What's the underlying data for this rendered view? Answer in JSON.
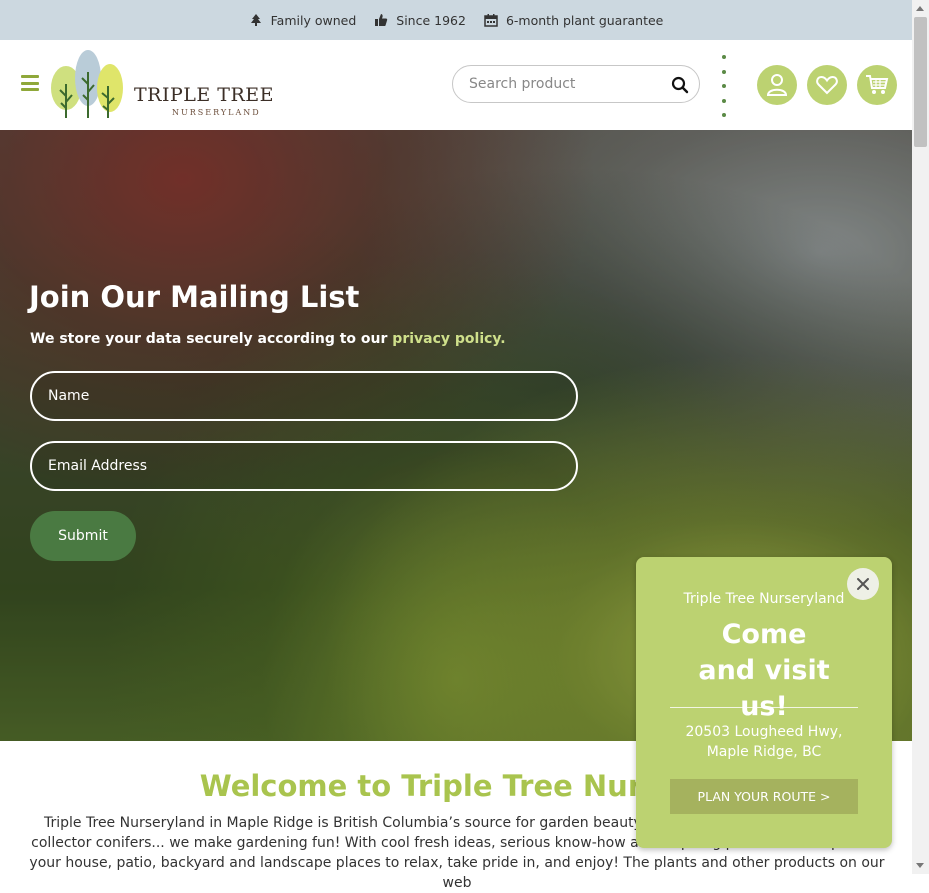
{
  "topbar": {
    "items": [
      {
        "icon": "tree-icon",
        "text": "Family owned"
      },
      {
        "icon": "thumbs-up-icon",
        "text": "Since 1962"
      },
      {
        "icon": "calendar-icon",
        "text": "6-month plant guarantee"
      }
    ]
  },
  "header": {
    "logo_line1": "TRIPLE TREE",
    "logo_line2": "NURSERYLAND",
    "search_placeholder": "Search product",
    "icons": [
      "menu-icon",
      "search-icon",
      "more-dots-icon",
      "account-icon",
      "heart-icon",
      "cart-icon"
    ],
    "accent": "#bcd271"
  },
  "hero": {
    "title": "Join Our Mailing List",
    "note_prefix": "We store your data securely according to our ",
    "note_link": "privacy policy.",
    "name_placeholder": "Name",
    "email_placeholder": "Email Address",
    "submit_label": "Submit",
    "submit_color": "#4a7a42"
  },
  "welcome": {
    "title": "Welcome to Triple Tree Nursery",
    "body": "Triple Tree Nurseryland in Maple Ridge is British Columbia’s source for garden beauty and inspiration. From our line of collector conifers... we make gardening fun! With cool fresh ideas, serious know-how and inspiring products to help make your house, patio, backyard and landscape places to relax, take pride in, and enjoy! The plants and other products on our web"
  },
  "popup": {
    "subtitle": "Triple Tree Nurseryland",
    "headline": "Come and visit us!",
    "address_line1": "20503 Lougheed Hwy,",
    "address_line2": "Maple Ridge, BC",
    "button_label": "PLAN YOUR ROUTE >",
    "close_icon": "close-icon",
    "background": "#bcd271"
  }
}
